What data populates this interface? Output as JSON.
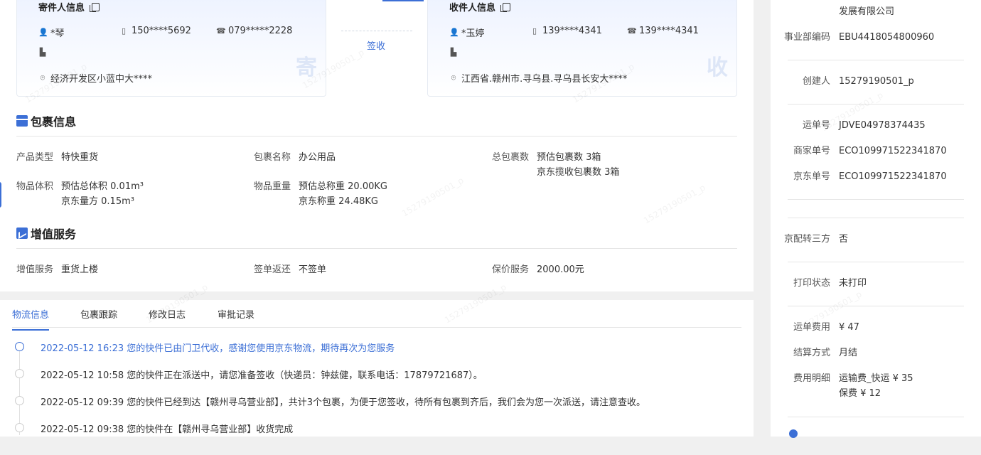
{
  "sender": {
    "title": "寄件人信息",
    "name": "*琴",
    "mobile": "150****5692",
    "phone": "079*****2228",
    "address": "经济开发区小蓝中大****",
    "badge": "寄"
  },
  "receiver": {
    "title": "收件人信息",
    "name": "*玉婷",
    "mobile": "139****4341",
    "phone": "139****4341",
    "address": "江西省.赣州市.寻乌县.寻乌县长安大****",
    "badge": "收"
  },
  "sign_status": "签收",
  "package": {
    "title": "包裹信息",
    "product_type_label": "产品类型",
    "product_type": "特快重货",
    "name_label": "包裹名称",
    "name": "办公用品",
    "count_label": "总包裹数",
    "count_est": "预估包裹数 3箱",
    "count_jd": "京东揽收包裹数 3箱",
    "volume_label": "物品体积",
    "volume_est": "预估总体积 0.01m³",
    "volume_jd": "京东量方 0.15m³",
    "weight_label": "物品重量",
    "weight_est": "预估总称重 20.00KG",
    "weight_jd": "京东称重 24.48KG"
  },
  "value_added": {
    "title": "增值服务",
    "service_label": "增值服务",
    "service": "重货上楼",
    "return_label": "签单返还",
    "return": "不签单",
    "insure_label": "保价服务",
    "insure": "2000.00元"
  },
  "tabs": [
    {
      "label": "物流信息"
    },
    {
      "label": "包裹跟踪"
    },
    {
      "label": "修改日志"
    },
    {
      "label": "审批记录"
    }
  ],
  "timeline": [
    {
      "text": "2022-05-12 16:23 您的快件已由门卫代收，感谢您使用京东物流，期待再次为您服务"
    },
    {
      "text": "2022-05-12 10:58 您的快件正在派送中，请您准备签收（快递员：钟兹健，联系电话：17879721687）。"
    },
    {
      "text": "2022-05-12 09:39 您的快件已经到达【赣州寻乌营业部】，共计3个包裹，为便于您签收，待所有包裹到齐后，我们会为您一次派送，请注意查收。"
    },
    {
      "text": "2022-05-12 09:38 您的快件在【赣州寻乌营业部】收货完成"
    }
  ],
  "side": {
    "company_tail": "发展有限公司",
    "bu_code_label": "事业部编码",
    "bu_code": "EBU4418054800960",
    "creator_label": "创建人",
    "creator": "15279190501_p",
    "waybill_label": "运单号",
    "waybill": "JDVE04978374435",
    "merchant_no_label": "商家单号",
    "merchant_no": "ECO109971522341870",
    "jd_no_label": "京东单号",
    "jd_no": "ECO109971522341870",
    "third_party_label": "京配转三方",
    "third_party": "否",
    "print_label": "打印状态",
    "print": "未打印",
    "fee_label": "运单费用",
    "fee": "¥ 47",
    "settle_label": "结算方式",
    "settle": "月结",
    "fee_detail_label": "费用明细",
    "fee_detail_1": "运输费_快运 ¥ 35",
    "fee_detail_2": "保费 ¥ 12"
  },
  "watermark": "15279190501_p",
  "accent_color": "#3c6fd6"
}
